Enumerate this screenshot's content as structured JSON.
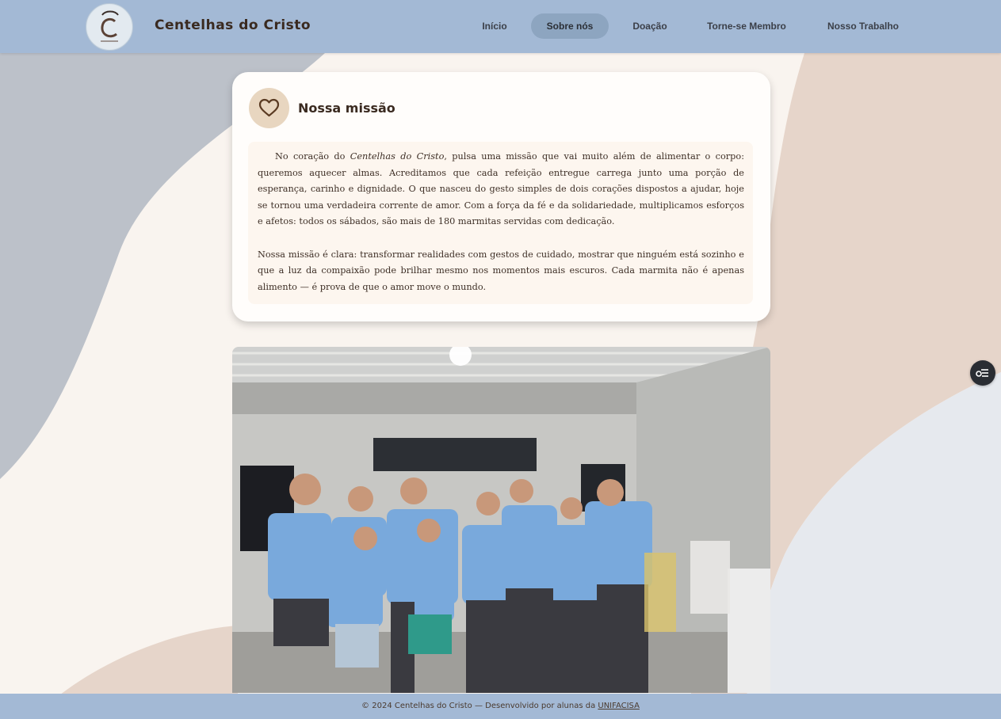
{
  "header": {
    "site_title": "Centelhas do Cristo",
    "logo_alt": "logo-icon"
  },
  "nav": {
    "items": [
      {
        "label": "Início",
        "active": false
      },
      {
        "label": "Sobre nós",
        "active": true
      },
      {
        "label": "Doação",
        "active": false
      },
      {
        "label": "Torne-se Membro",
        "active": false
      },
      {
        "label": "Nosso Trabalho",
        "active": false
      }
    ]
  },
  "mission": {
    "icon": "heart-icon",
    "title": "Nossa missão",
    "p1_before": "No coração do ",
    "p1_em": "Centelhas do Cristo",
    "p1_after": ", pulsa uma missão que vai muito além de alimentar o corpo: queremos aquecer almas. Acreditamos que cada refeição entregue carrega junto uma porção de esperança, carinho e dignidade. O que nasceu do gesto simples de dois corações dispostos a ajudar, hoje se tornou uma verdadeira corrente de amor. Com a força da fé e da solidariedade, multiplicamos esforços e afetos: todos os sábados, são mais de 180 marmitas servidas com dedicação.",
    "p2": "Nossa missão é clara: transformar realidades com gestos de cuidado, mostrar que ninguém está sozinho e que a luz da compaixão pode brilhar mesmo nos momentos mais escuros. Cada marmita não é apenas alimento — é prova de que o amor move o mundo."
  },
  "floating_button": {
    "icon": "list-menu-icon"
  },
  "footer": {
    "text": "© 2024 Centelhas do Cristo — Desenvolvido por alunas da ",
    "link": "UNIFACISA"
  },
  "colors": {
    "header_bg": "#a3b9d5",
    "nav_active_bg": "#8da5c0",
    "card_bg": "#fffdfb",
    "heart_circle": "#e8d6c0",
    "text_brown": "#3a2a20"
  }
}
